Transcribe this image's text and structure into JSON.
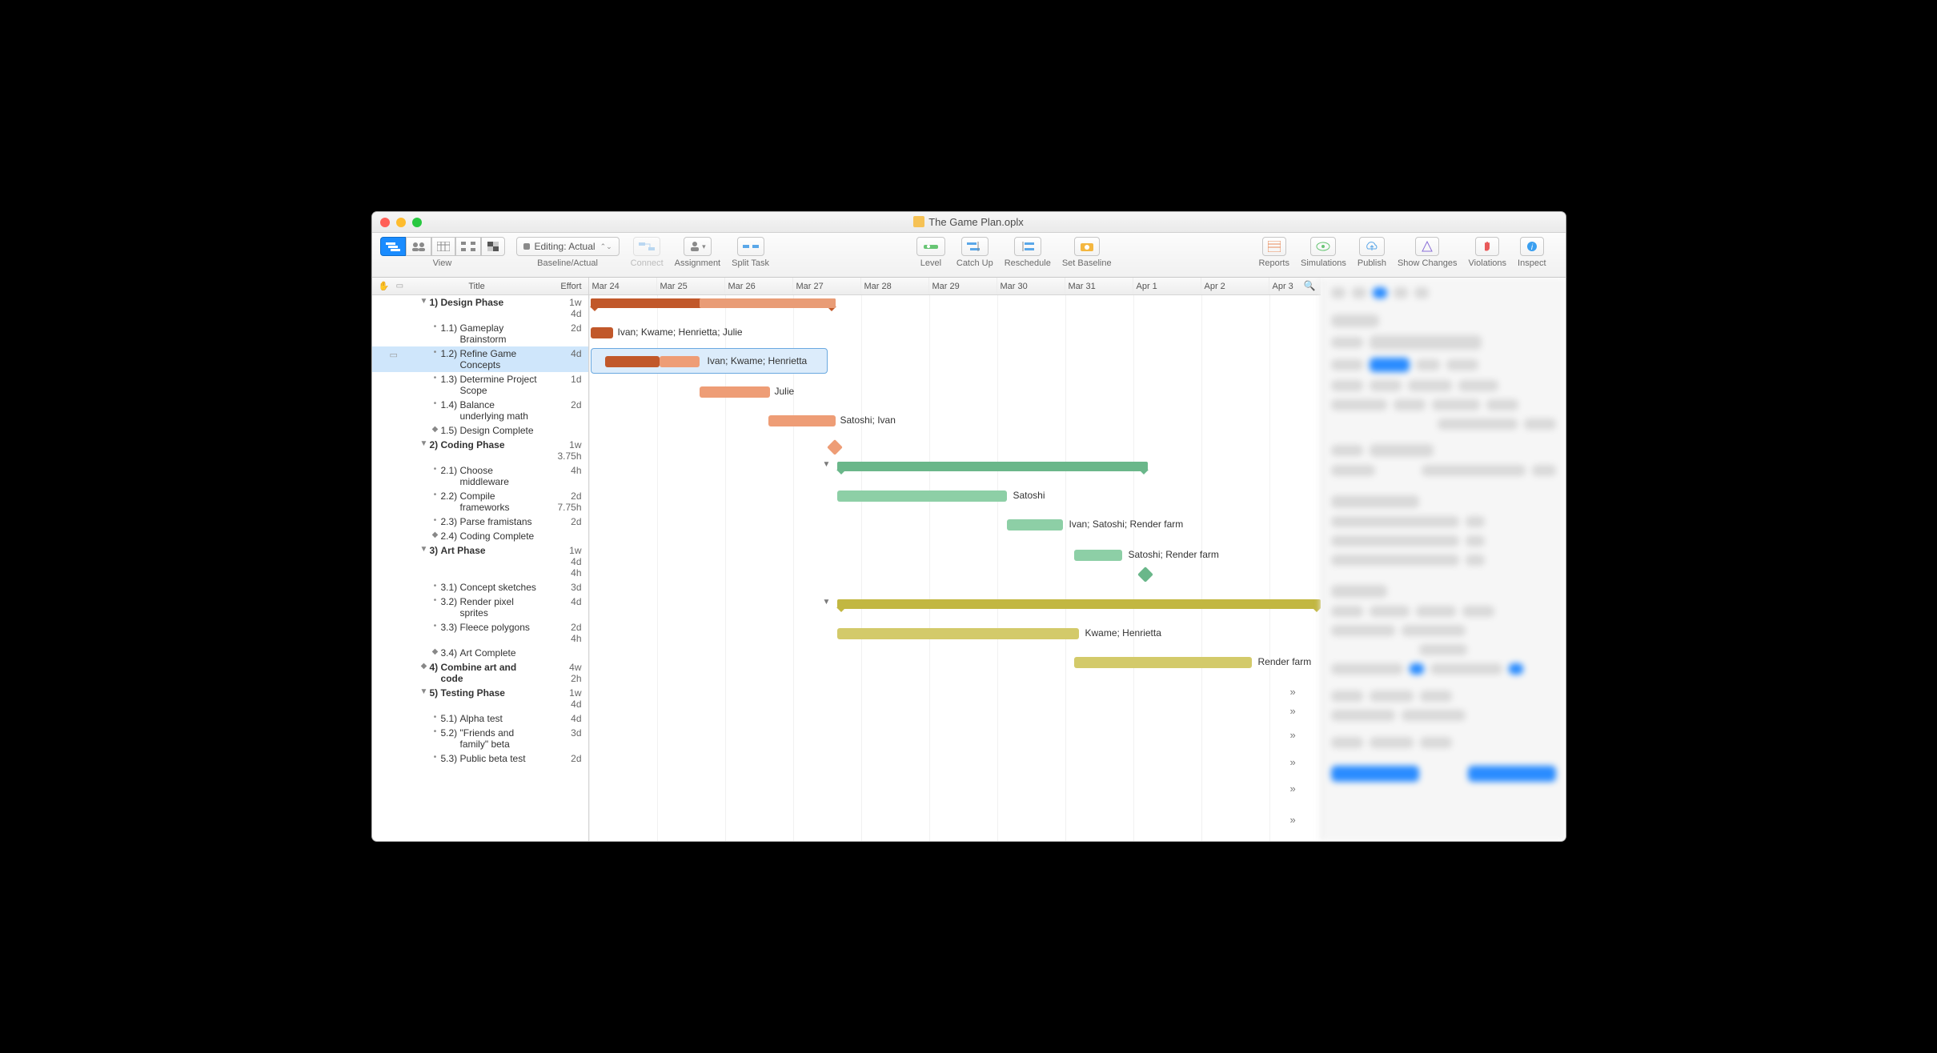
{
  "window": {
    "title": "The Game Plan.oplx"
  },
  "toolbar": {
    "view_label": "View",
    "baseline_label": "Baseline/Actual",
    "editing_label": "Editing: Actual",
    "connect": "Connect",
    "assignment": "Assignment",
    "split_task": "Split Task",
    "level": "Level",
    "catch_up": "Catch Up",
    "reschedule": "Reschedule",
    "set_baseline": "Set Baseline",
    "reports": "Reports",
    "simulations": "Simulations",
    "publish": "Publish",
    "show_changes": "Show Changes",
    "violations": "Violations",
    "inspect": "Inspect"
  },
  "outline": {
    "col_title": "Title",
    "col_effort": "Effort",
    "rows": [
      {
        "type": "group",
        "num": "1)",
        "title": "Design Phase",
        "effort": "1w 4d"
      },
      {
        "type": "task",
        "num": "1.1)",
        "title": "Gameplay Brainstorm",
        "effort": "2d"
      },
      {
        "type": "task",
        "num": "1.2)",
        "title": "Refine Game Concepts",
        "effort": "4d",
        "selected": true,
        "note": true
      },
      {
        "type": "task",
        "num": "1.3)",
        "title": "Determine Project Scope",
        "effort": "1d"
      },
      {
        "type": "task",
        "num": "1.4)",
        "title": "Balance underlying math",
        "effort": "2d"
      },
      {
        "type": "milestone",
        "num": "1.5)",
        "title": "Design Complete",
        "effort": ""
      },
      {
        "type": "group",
        "num": "2)",
        "title": "Coding Phase",
        "effort": "1w 3.75h"
      },
      {
        "type": "task",
        "num": "2.1)",
        "title": "Choose middleware",
        "effort": "4h"
      },
      {
        "type": "task",
        "num": "2.2)",
        "title": "Compile frameworks",
        "effort": "2d 7.75h"
      },
      {
        "type": "task",
        "num": "2.3)",
        "title": "Parse framistans",
        "effort": "2d"
      },
      {
        "type": "milestone",
        "num": "2.4)",
        "title": "Coding Complete",
        "effort": ""
      },
      {
        "type": "group",
        "num": "3)",
        "title": "Art Phase",
        "effort": "1w 4d 4h"
      },
      {
        "type": "task",
        "num": "3.1)",
        "title": "Concept sketches",
        "effort": "3d"
      },
      {
        "type": "task",
        "num": "3.2)",
        "title": "Render pixel sprites",
        "effort": "4d"
      },
      {
        "type": "task",
        "num": "3.3)",
        "title": "Fleece polygons",
        "effort": "2d 4h"
      },
      {
        "type": "milestone",
        "num": "3.4)",
        "title": "Art Complete",
        "effort": ""
      },
      {
        "type": "group",
        "num": "4)",
        "title": "Combine art and code",
        "effort": "4w 2h",
        "leaf": true
      },
      {
        "type": "group",
        "num": "5)",
        "title": "Testing Phase",
        "effort": "1w 4d"
      },
      {
        "type": "task",
        "num": "5.1)",
        "title": "Alpha test",
        "effort": "4d"
      },
      {
        "type": "task",
        "num": "5.2)",
        "title": "\"Friends and family\" beta",
        "effort": "3d"
      },
      {
        "type": "task",
        "num": "5.3)",
        "title": "Public beta test",
        "effort": "2d"
      }
    ]
  },
  "gantt": {
    "dates": [
      "Mar 24",
      "Mar 25",
      "Mar 26",
      "Mar 27",
      "Mar 28",
      "Mar 29",
      "Mar 30",
      "Mar 31",
      "Apr 1",
      "Apr 2",
      "Apr 3"
    ],
    "labels": {
      "l1": "Ivan; Kwame; Henrietta; Julie",
      "l2": "Ivan; Kwame; Henrietta",
      "l3": "Julie",
      "l4": "Satoshi; Ivan",
      "l5": "Satoshi",
      "l6": "Ivan; Satoshi; Render farm",
      "l7": "Satoshi; Render farm",
      "l8": "Kwame; Henrietta",
      "l9": "Render farm"
    }
  }
}
